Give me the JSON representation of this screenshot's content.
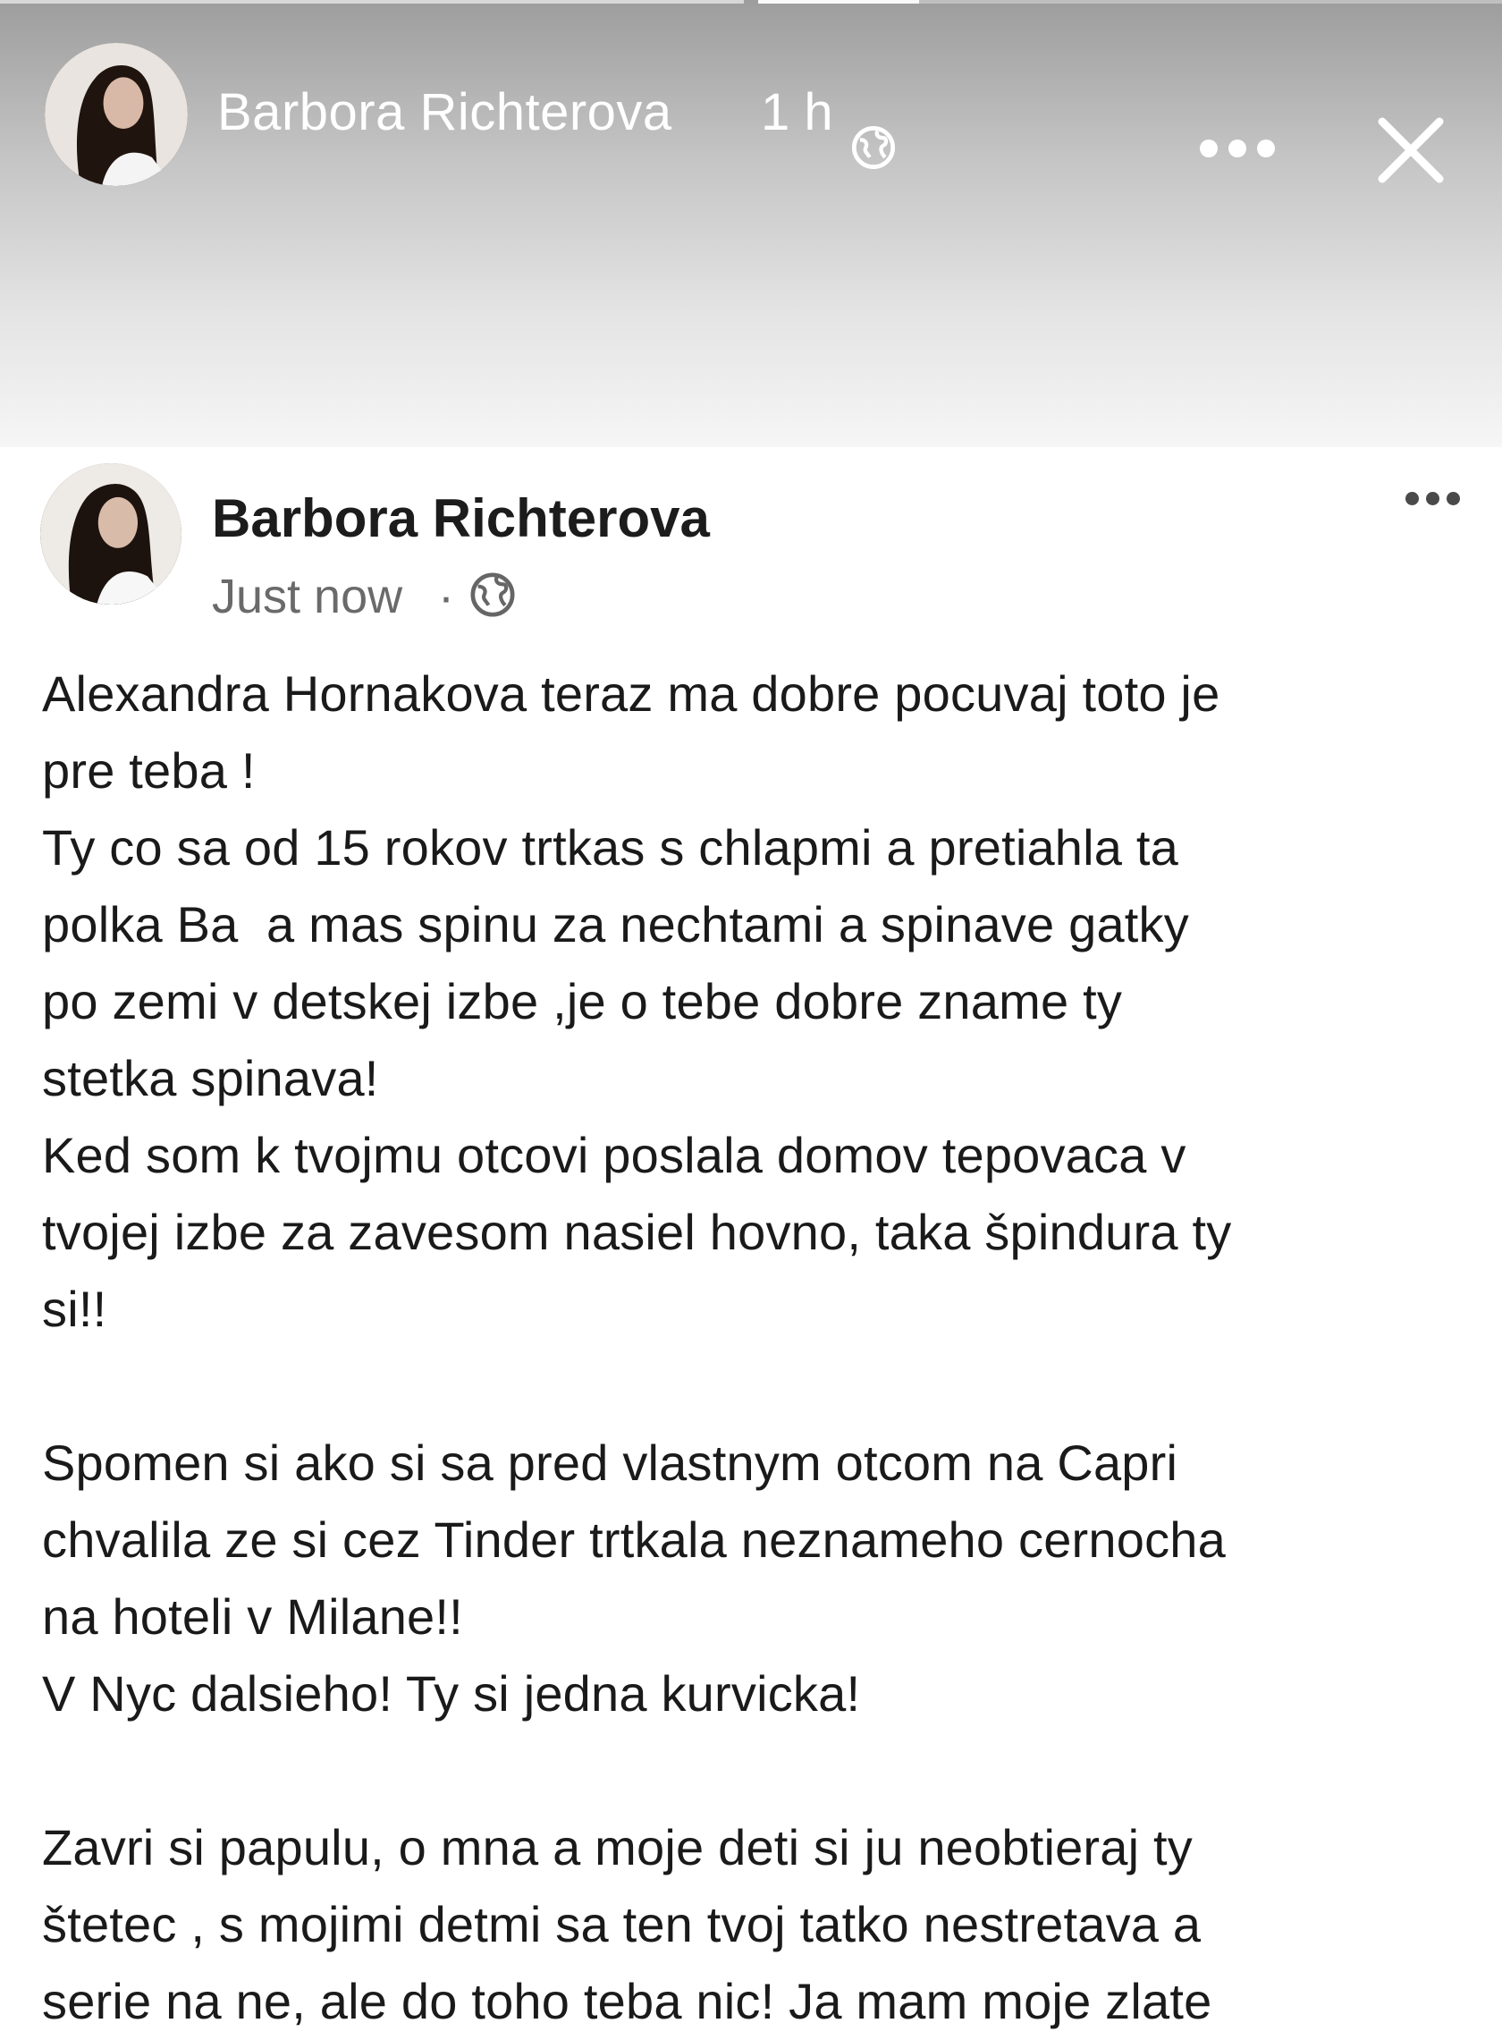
{
  "story": {
    "author": "Barbora Richterova",
    "time": "1 h",
    "icons": {
      "privacy": "globe-icon",
      "more": "more-icon",
      "close": "close-icon"
    }
  },
  "post": {
    "author": "Barbora Richterova",
    "time": "Just now",
    "separator": "·",
    "lines": [
      "Alexandra Hornakova teraz ma dobre pocuvaj toto je",
      "pre teba !",
      "Ty co sa od 15 rokov trtkas s chlapmi a pretiahla ta",
      "polka Ba  a mas spinu za nechtami a spinave gatky",
      "po zemi v detskej izbe ,je o tebe dobre zname ty",
      "stetka spinava!",
      "Ked som k tvojmu otcovi poslala domov tepovaca v",
      "tvojej izbe za zavesom nasiel hovno, taka špindura ty",
      "si!!",
      "",
      "Spomen si ako si sa pred vlastnym otcom na Capri",
      "chvalila ze si cez Tinder trtkala neznameho cernocha",
      "na hoteli v Milane!!",
      "V Nyc dalsieho! Ty si jedna kurvicka!",
      "",
      "Zavri si papulu, o mna a moje deti si ju neobtieraj ty",
      "štetec , s mojimi detmi sa ten tvoj tatko nestretava a",
      "serie na ne, ale do toho teba nic! Ja mam moje zlate"
    ]
  }
}
